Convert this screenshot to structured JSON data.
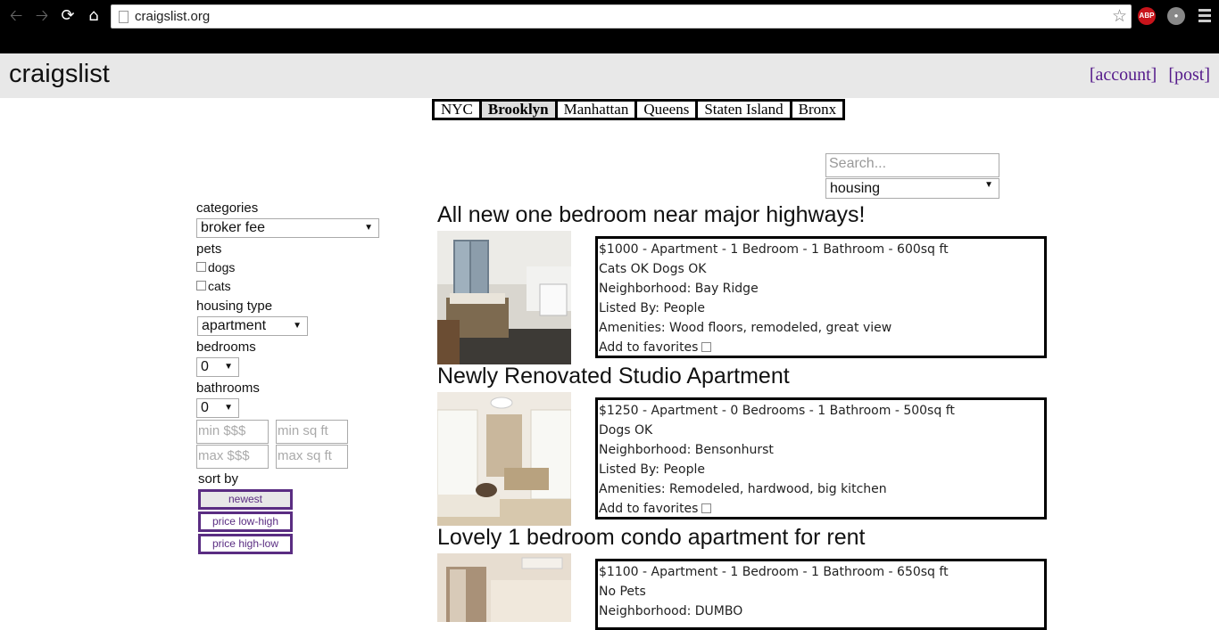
{
  "browser": {
    "url": "craigslist.org",
    "extensions": [
      "ABP"
    ]
  },
  "header": {
    "logo": "craigslist",
    "account_label": "[account]",
    "post_label": "[post]"
  },
  "boroughs": [
    {
      "label": "NYC",
      "active": false
    },
    {
      "label": "Brooklyn",
      "active": true
    },
    {
      "label": "Manhattan",
      "active": false
    },
    {
      "label": "Queens",
      "active": false
    },
    {
      "label": "Staten Island",
      "active": false
    },
    {
      "label": "Bronx",
      "active": false
    }
  ],
  "search": {
    "placeholder": "Search...",
    "category": "housing"
  },
  "filters": {
    "categories_label": "categories",
    "category_value": "broker fee",
    "pets_label": "pets",
    "dogs_label": "dogs",
    "cats_label": "cats",
    "housing_type_label": "housing type",
    "housing_type_value": "apartment",
    "bedrooms_label": "bedrooms",
    "bedrooms_value": "0",
    "bathrooms_label": "bathrooms",
    "bathrooms_value": "0",
    "min_price_placeholder": "min $$$",
    "min_sqft_placeholder": "min sq ft",
    "max_price_placeholder": "max $$$",
    "max_sqft_placeholder": "max sq ft",
    "sort_label": "sort by",
    "sort_options": [
      "newest",
      "price low-high",
      "price high-low"
    ]
  },
  "listings": [
    {
      "title": "All new one bedroom near major highways!",
      "summary": "$1000 - Apartment - 1 Bedroom - 1 Bathroom - 600sq ft",
      "pets": "Cats OK Dogs OK",
      "neighborhood": "Neighborhood: Bay Ridge",
      "listed_by": "Listed By: People",
      "amenities": "Amenities: Wood floors, remodeled, great view",
      "favorites_label": "Add to favorites"
    },
    {
      "title": "Newly Renovated Studio Apartment",
      "summary": "$1250 - Apartment - 0 Bedrooms - 1 Bathroom - 500sq ft",
      "pets": "Dogs OK",
      "neighborhood": "Neighborhood: Bensonhurst",
      "listed_by": "Listed By: People",
      "amenities": "Amenities: Remodeled, hardwood, big kitchen",
      "favorites_label": "Add to favorites"
    },
    {
      "title": "Lovely 1 bedroom condo apartment for rent",
      "summary": "$1100 - Apartment - 1 Bedroom - 1 Bathroom - 650sq ft",
      "pets": "No Pets",
      "neighborhood": "Neighborhood: DUMBO",
      "listed_by": "",
      "amenities": "",
      "favorites_label": ""
    }
  ]
}
